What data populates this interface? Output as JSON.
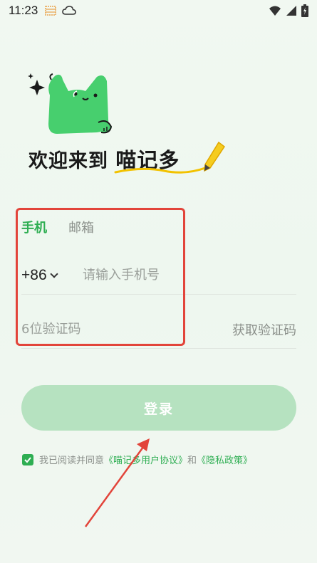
{
  "status_bar": {
    "time": "11:23",
    "icons_left": [
      "calendar-grid-icon",
      "cloud-icon"
    ],
    "icons_right": [
      "wifi-icon",
      "cellular-signal-icon",
      "battery-icon"
    ]
  },
  "hero": {
    "mascot": "green-cat-mascot",
    "welcome_text": "欢迎来到",
    "brand_name": "喵记多"
  },
  "tabs": [
    {
      "label": "手机",
      "active": true
    },
    {
      "label": "邮箱",
      "active": false
    }
  ],
  "phone": {
    "country_code": "+86",
    "placeholder": "请输入手机号",
    "value": ""
  },
  "code": {
    "placeholder": "6位验证码",
    "value": "",
    "get_code_label": "获取验证码"
  },
  "login_button": {
    "label": "登录",
    "enabled": false
  },
  "agreement": {
    "checked": true,
    "prefix": "我已阅读并同意",
    "user_agreement": "《喵记多用户协议》",
    "and": "和",
    "privacy_policy": "《隐私政策》"
  },
  "colors": {
    "accent": "#2eae52",
    "button_disabled": "#b6e2c0",
    "annotation_red": "#e2443a",
    "mascot_green": "#47cf6e"
  }
}
